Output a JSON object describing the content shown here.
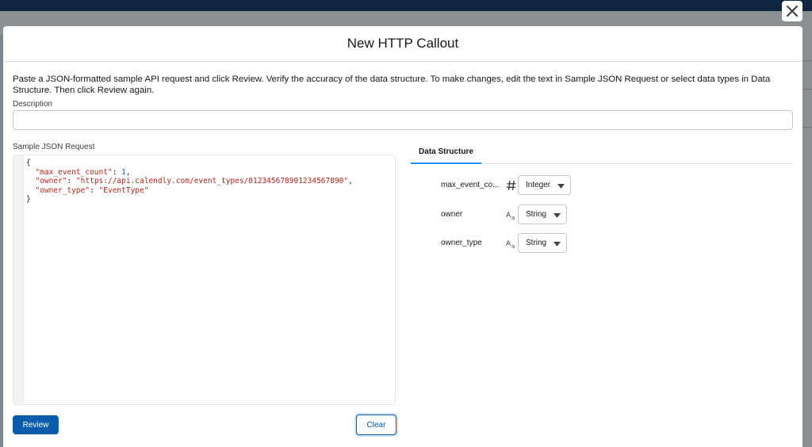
{
  "modal": {
    "title": "New HTTP Callout",
    "instructions": "Paste a JSON-formatted sample API request and click Review. Verify the accuracy of the data structure. To make changes, edit the text in Sample JSON Request or select data types in Data Structure. Then click Review again.",
    "description": {
      "label": "Description",
      "value": "",
      "placeholder": ""
    },
    "sample_json": {
      "label": "Sample JSON Request",
      "lines": {
        "open": "{",
        "l1_key": "\"max_event_count\"",
        "l1_val": "1",
        "l2_key": "\"owner\"",
        "l2_val": "\"https://api.calendly.com/event_types/012345678901234567890\"",
        "l3_key": "\"owner_type\"",
        "l3_val": "\"EventType\"",
        "close": "}"
      }
    },
    "buttons": {
      "review": "Review",
      "clear": "Clear"
    },
    "data_structure": {
      "tab_label": "Data Structure",
      "fields": [
        {
          "name": "max_event_co...",
          "icon": "number-icon",
          "type": "Integer"
        },
        {
          "name": "owner",
          "icon": "text-icon",
          "type": "String"
        },
        {
          "name": "owner_type",
          "icon": "text-icon",
          "type": "String"
        }
      ]
    }
  },
  "colors": {
    "brand": "#0b5cab",
    "tab_accent": "#1b96ff",
    "json_string": "#b3261e",
    "json_number": "#1f5fa8",
    "overlay": "#7f8488",
    "top_bar": "#0f2540"
  }
}
